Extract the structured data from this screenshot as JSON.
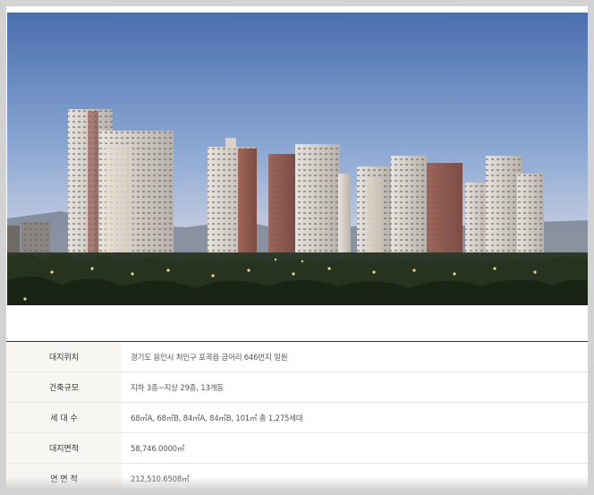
{
  "hero": {
    "image_name": "apartment-complex-night-rendering"
  },
  "info_rows": [
    {
      "label": "대지위치",
      "value": "경기도 용인시 처인구 포곡읍 금어리 646번지 일원"
    },
    {
      "label": "건축규모",
      "value": "지하 3층~지상 29층, 13개동"
    },
    {
      "label": "세 대 수",
      "value": "68㎡A, 68㎡B, 84㎡A, 84㎡B, 101㎡ 총 1,275세대"
    },
    {
      "label": "대지면적",
      "value": "58,746.0000㎡"
    },
    {
      "label": "연 면 적",
      "value": "212,510.6508㎡"
    }
  ],
  "colors": {
    "label_bg": "#f8f6f2",
    "table_border": "#333333",
    "frame": "#d2d2d2"
  }
}
